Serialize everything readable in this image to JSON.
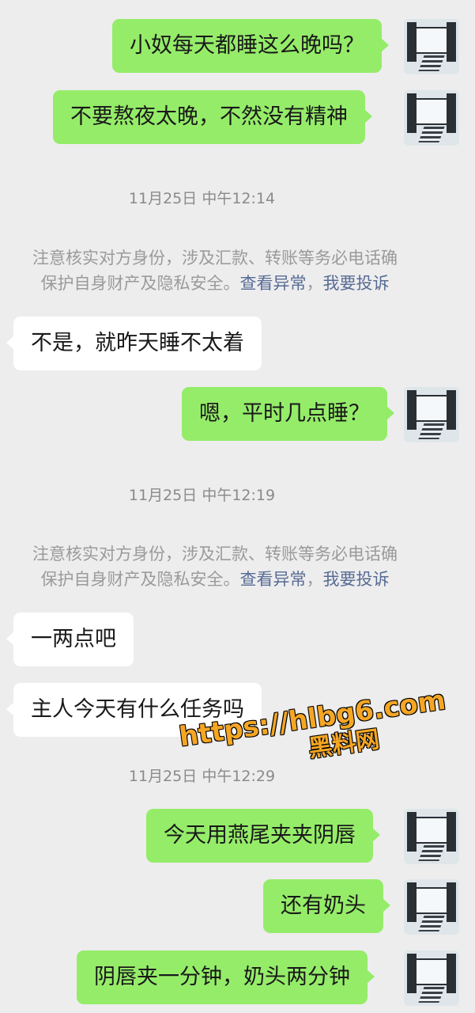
{
  "messages": [
    {
      "text": "小奴每天都睡这么晚吗？"
    },
    {
      "text": "不要熬夜太晚，不然没有精神"
    },
    {
      "text": "不是，就昨天睡不太着"
    },
    {
      "text": "嗯，平时几点睡？"
    },
    {
      "text": "一两点吧"
    },
    {
      "text": "主人今天有什么任务吗"
    },
    {
      "text": "今天用燕尾夹夹阴唇"
    },
    {
      "text": "还有奶头"
    },
    {
      "text": "阴唇夹一分钟，奶头两分钟"
    }
  ],
  "timestamps": [
    "11月25日 中午12:14",
    "11月25日 中午12:19",
    "11月25日 中午12:29"
  ],
  "notice": {
    "line1": "注意核实对方身份，涉及汇款、转账等务必电话确",
    "line2": "保护自身财产及隐私安全。",
    "link1": "查看异常",
    "sep": "，",
    "link2": "我要投诉"
  },
  "watermark": {
    "url": "https://hlbg6.com",
    "name": "黑料网"
  }
}
